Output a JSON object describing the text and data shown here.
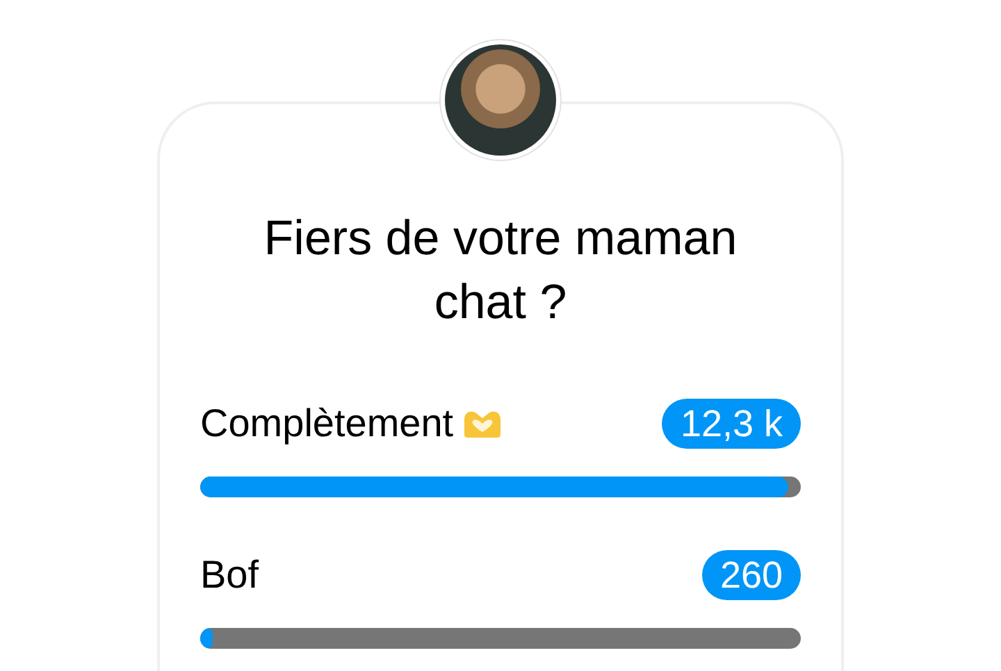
{
  "poll": {
    "question": "Fiers de votre maman chat ?",
    "options": [
      {
        "kind": "with-emoji",
        "label": "Complètement",
        "count": "12,3 k",
        "level": 0.98
      },
      {
        "kind": "plain",
        "label": "Bof",
        "count": "260",
        "level": 0.02
      }
    ]
  }
}
